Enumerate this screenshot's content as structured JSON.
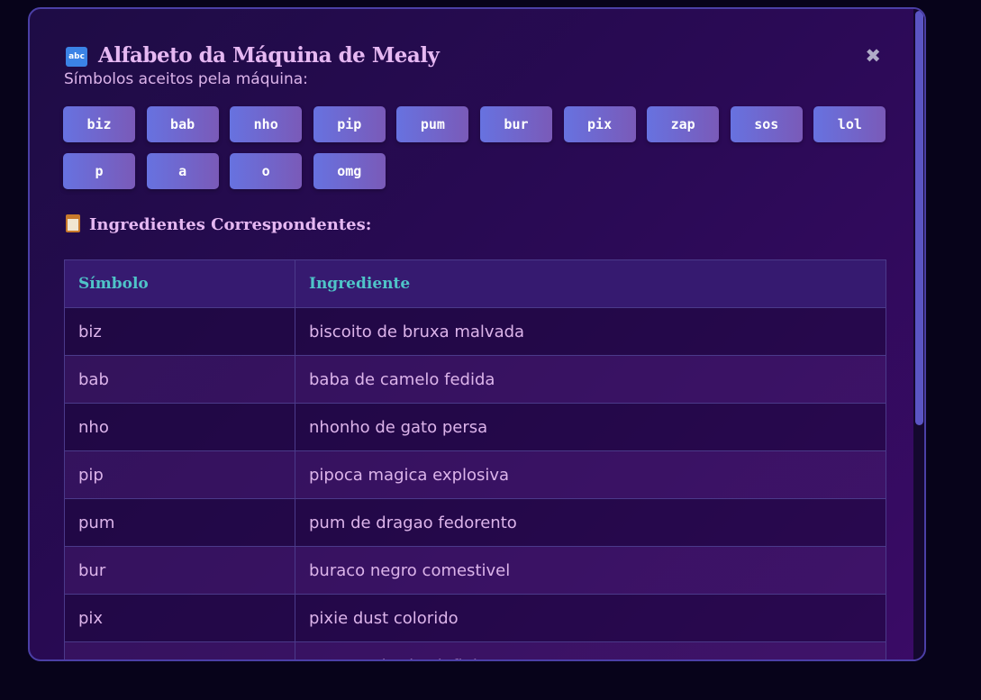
{
  "modal": {
    "title_icon": "abc",
    "title": "Alfabeto da Máquina de Mealy",
    "close_icon": "✖",
    "subtitle": "Símbolos aceitos pela máquina:"
  },
  "symbols": [
    "biz",
    "bab",
    "nho",
    "pip",
    "pum",
    "bur",
    "pix",
    "zap",
    "sos",
    "lol",
    "p",
    "a",
    "o",
    "omg"
  ],
  "ingredients": {
    "heading": "Ingredientes Correspondentes:",
    "columns": [
      "Símbolo",
      "Ingrediente"
    ],
    "rows": [
      [
        "biz",
        "biscoito de bruxa malvada"
      ],
      [
        "bab",
        "baba de camelo fedida"
      ],
      [
        "nho",
        "nhonho de gato persa"
      ],
      [
        "pip",
        "pipoca magica explosiva"
      ],
      [
        "pum",
        "pum de dragao fedorento"
      ],
      [
        "bur",
        "buraco negro comestivel"
      ],
      [
        "pix",
        "pixie dust colorido"
      ],
      [
        "zap",
        "zapzap eletrico infinito"
      ]
    ]
  },
  "colors": {
    "accent_title": "#e6b8f2",
    "table_header_text": "#4fc4c8",
    "symbol_button": "#6772e0"
  }
}
